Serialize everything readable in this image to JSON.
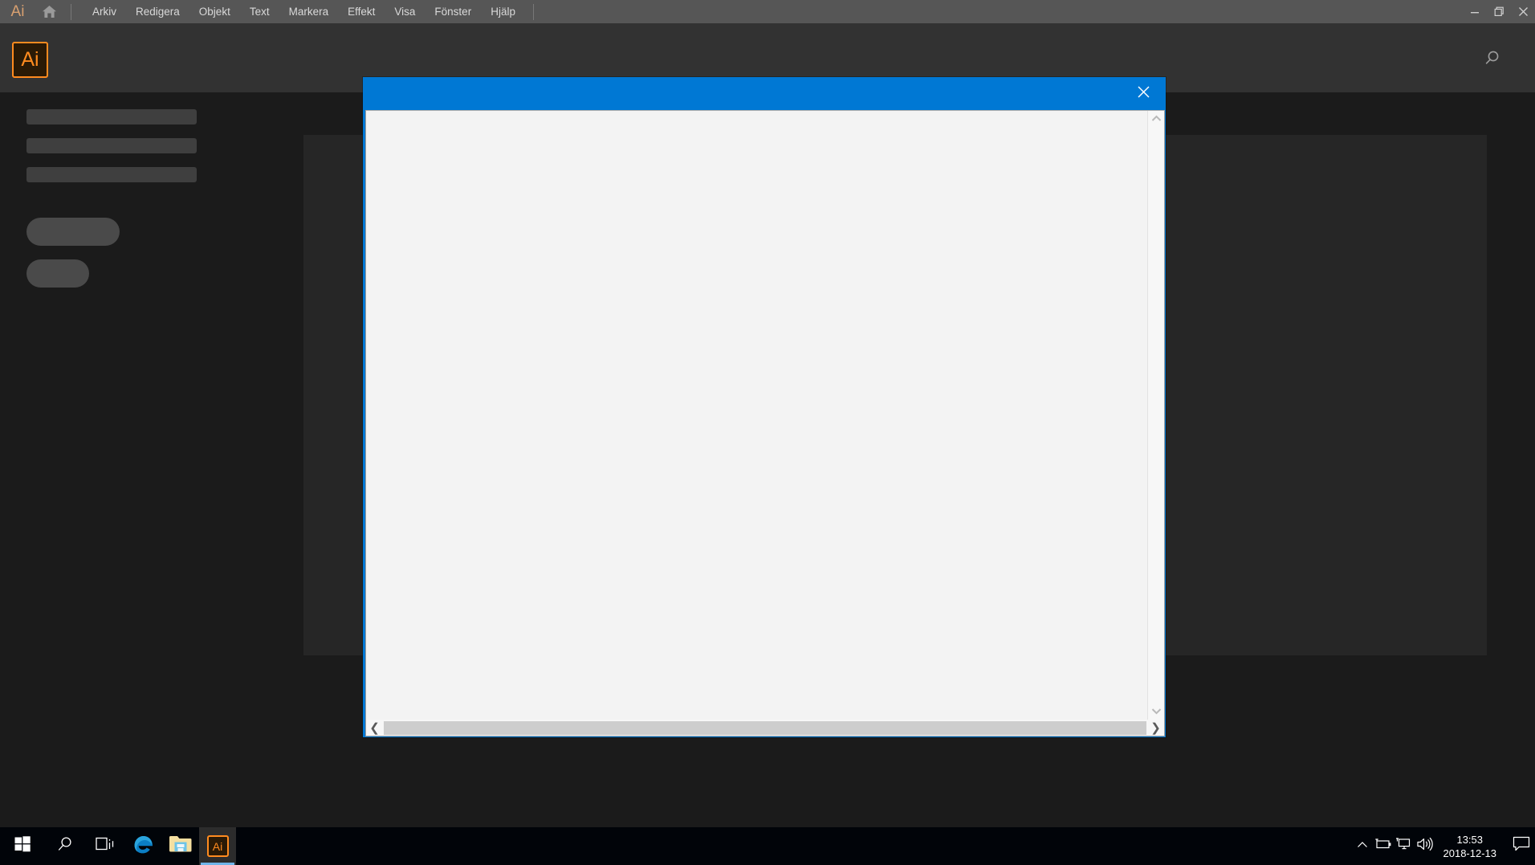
{
  "app": {
    "name": "Adobe Illustrator",
    "wordmark": "Ai",
    "logo_text": "Ai",
    "accent_orange": "#ff8b1f",
    "titlebar_bg": "#565656",
    "header_bg": "#323232",
    "body_bg": "#1b1b1b"
  },
  "titlebar": {
    "home_icon": "home-icon",
    "menu": [
      {
        "label": "Arkiv"
      },
      {
        "label": "Redigera"
      },
      {
        "label": "Objekt"
      },
      {
        "label": "Text"
      },
      {
        "label": "Markera"
      },
      {
        "label": "Effekt"
      },
      {
        "label": "Visa"
      },
      {
        "label": "Fönster"
      },
      {
        "label": "Hjälp"
      }
    ],
    "window_controls": [
      {
        "name": "minimize-button",
        "icon": "minimize-icon"
      },
      {
        "name": "restore-button",
        "icon": "restore-icon"
      },
      {
        "name": "close-button",
        "icon": "close-icon"
      }
    ]
  },
  "home": {
    "search_icon": "search-icon",
    "placeholders": {
      "bar1": "",
      "bar2": "",
      "bar3": "",
      "pill1": "",
      "pill2": ""
    }
  },
  "dialog": {
    "title": "",
    "close_icon": "close-icon",
    "title_bg": "#0078d4",
    "body_bg": "#f3f3f3",
    "vertical_scrollbar": {
      "up_icon": "chevron-up-icon",
      "down_icon": "chevron-down-icon"
    },
    "horizontal_scrollbar": {
      "left_icon": "chevron-left-icon",
      "right_icon": "chevron-right-icon",
      "left_glyph": "❮",
      "right_glyph": "❯"
    }
  },
  "taskbar": {
    "bg": "#010409",
    "items": [
      {
        "name": "start-button",
        "icon": "windows-logo-icon",
        "label": "Start",
        "active": false
      },
      {
        "name": "search-button",
        "icon": "search-icon",
        "label": "Sök",
        "active": false
      },
      {
        "name": "task-view-button",
        "icon": "task-view-icon",
        "label": "Aktivitetsvy",
        "active": false
      },
      {
        "name": "edge-button",
        "icon": "edge-icon",
        "label": "Microsoft Edge",
        "active": false
      },
      {
        "name": "file-explorer-button",
        "icon": "folder-icon",
        "label": "Utforskaren",
        "active": false
      },
      {
        "name": "illustrator-button",
        "icon": "illustrator-icon",
        "label": "Adobe Illustrator",
        "active": true
      }
    ],
    "tray": {
      "icons": [
        {
          "name": "show-hidden-icons",
          "icon": "chevron-up-icon"
        },
        {
          "name": "battery-icon",
          "icon": "battery-icon"
        },
        {
          "name": "network-icon",
          "icon": "network-icon"
        },
        {
          "name": "volume-icon",
          "icon": "volume-icon"
        }
      ],
      "clock": {
        "time": "13:53",
        "date": "2018-12-13"
      },
      "action_center": {
        "name": "action-center-button",
        "icon": "speech-bubble-icon"
      }
    },
    "active_indicator_color": "#6fb4e8"
  }
}
